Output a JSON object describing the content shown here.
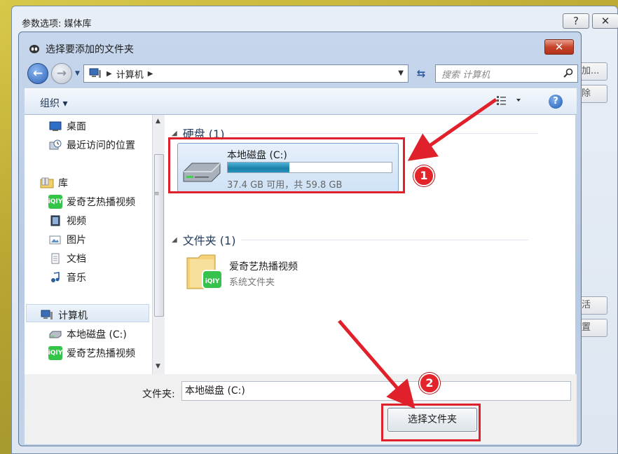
{
  "outer_dialog": {
    "title": "参数选项: 媒体库",
    "help_btn": "?",
    "close_btn": "✕",
    "side_buttons": [
      "加...",
      "除",
      "活",
      "置"
    ]
  },
  "dialog": {
    "title": "选择要添加的文件夹",
    "close": "✕"
  },
  "address": {
    "path": [
      "计算机"
    ],
    "search_placeholder": "搜索 计算机"
  },
  "toolbar": {
    "organize": "组织 ▾",
    "help": "?"
  },
  "nav": {
    "items": [
      {
        "label": "桌面",
        "icon": "desktop-icon"
      },
      {
        "label": "最近访问的位置",
        "icon": "recent-places-icon"
      },
      {
        "label": "库",
        "icon": "library-icon"
      },
      {
        "label": "爱奇艺热播视频",
        "icon": "iqiyi-icon"
      },
      {
        "label": "视频",
        "icon": "video-icon"
      },
      {
        "label": "图片",
        "icon": "pictures-icon"
      },
      {
        "label": "文档",
        "icon": "documents-icon"
      },
      {
        "label": "音乐",
        "icon": "music-icon"
      },
      {
        "label": "计算机",
        "icon": "computer-icon"
      },
      {
        "label": "本地磁盘 (C:)",
        "icon": "drive-icon"
      },
      {
        "label": "爱奇艺热播视频",
        "icon": "iqiyi-icon"
      }
    ]
  },
  "content": {
    "group_disks": "硬盘 (1)",
    "disk": {
      "name": "本地磁盘 (C:)",
      "info": "37.4 GB 可用，共 59.8 GB",
      "used_fraction": 0.375
    },
    "group_folders": "文件夹 (1)",
    "folder": {
      "name": "爱奇艺热播视频",
      "sub": "系统文件夹",
      "badge": "iQIY"
    }
  },
  "footer": {
    "folder_label": "文件夹:",
    "folder_value": "本地磁盘 (C:)",
    "select_button": "选择文件夹"
  },
  "annotations": {
    "badge1": "1",
    "badge2": "2"
  },
  "colors": {
    "accent": "#e0202a",
    "selection": "#cfe2f6"
  }
}
